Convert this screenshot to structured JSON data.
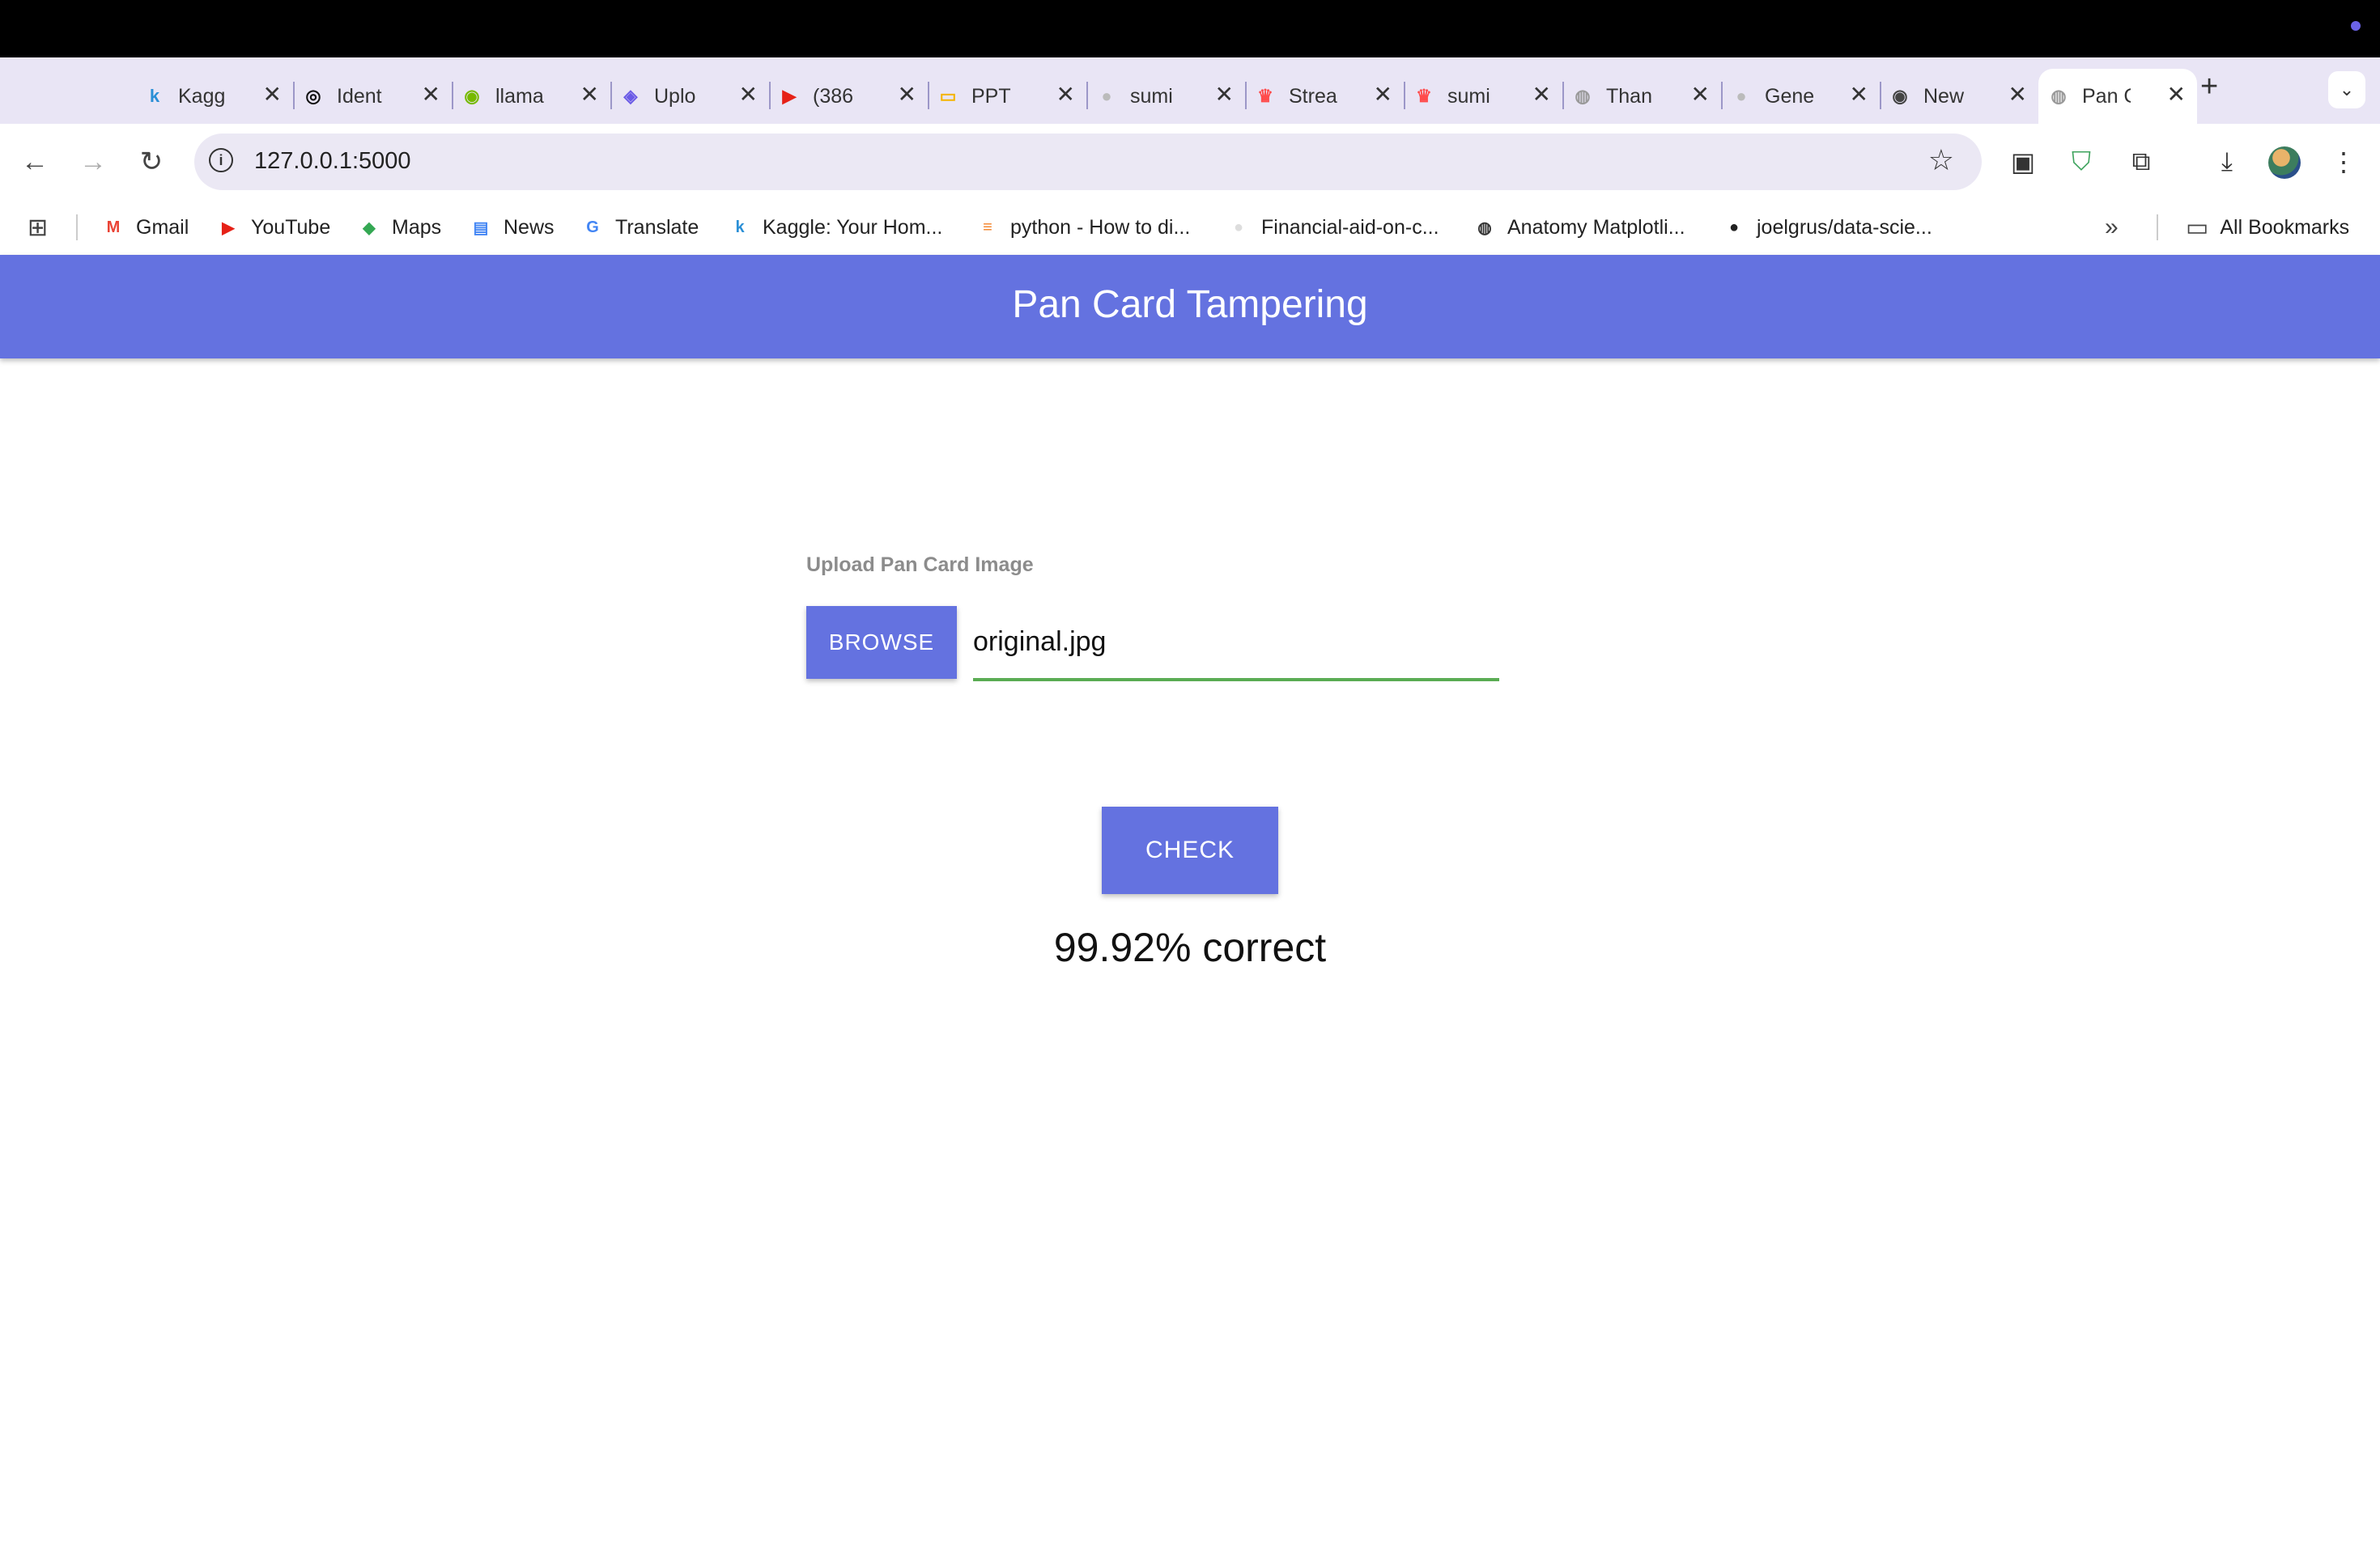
{
  "browser": {
    "tabs": [
      {
        "title": "Kagg",
        "icon": "kaggle-icon",
        "color": "#2a8fd6",
        "glyph": "k"
      },
      {
        "title": "Ident",
        "icon": "openai-icon",
        "color": "#111111",
        "glyph": "◎"
      },
      {
        "title": "llama",
        "icon": "nvidia-icon",
        "color": "#76b900",
        "glyph": "◉"
      },
      {
        "title": "Uplo",
        "icon": "upload-app-icon",
        "color": "#6a5ae6",
        "glyph": "◈"
      },
      {
        "title": "(386",
        "icon": "youtube-icon",
        "color": "#e62117",
        "glyph": "▶"
      },
      {
        "title": "PPT",
        "icon": "slides-icon",
        "color": "#f4b400",
        "glyph": "▭"
      },
      {
        "title": "sumi",
        "icon": "github-icon",
        "color": "#bbbbbb",
        "glyph": "●"
      },
      {
        "title": "Strea",
        "icon": "streamlit-icon",
        "color": "#ff4b4b",
        "glyph": "♛"
      },
      {
        "title": "sumi",
        "icon": "streamlit-app-icon",
        "color": "#ff4b4b",
        "glyph": "♛"
      },
      {
        "title": "Than",
        "icon": "globe-icon",
        "color": "#999999",
        "glyph": "◍"
      },
      {
        "title": "Gene",
        "icon": "github-icon",
        "color": "#bbbbbb",
        "glyph": "●"
      },
      {
        "title": "New",
        "icon": "chrome-icon",
        "color": "#444444",
        "glyph": "◉"
      },
      {
        "title": "Pan C",
        "icon": "globe-icon",
        "color": "#999999",
        "glyph": "◍"
      }
    ],
    "url": "127.0.0.1:5000",
    "bookmarks": [
      {
        "label": "Gmail",
        "icon": "gmail-icon",
        "color": "#ea4335",
        "glyph": "M"
      },
      {
        "label": "YouTube",
        "icon": "youtube-icon",
        "color": "#e62117",
        "glyph": "▶"
      },
      {
        "label": "Maps",
        "icon": "maps-icon",
        "color": "#34a853",
        "glyph": "◆"
      },
      {
        "label": "News",
        "icon": "news-icon",
        "color": "#4285f4",
        "glyph": "▤"
      },
      {
        "label": "Translate",
        "icon": "translate-icon",
        "color": "#4285f4",
        "glyph": "G"
      },
      {
        "label": "Kaggle: Your Hom...",
        "icon": "kaggle-icon",
        "color": "#2a8fd6",
        "glyph": "k"
      },
      {
        "label": "python - How to di...",
        "icon": "stackoverflow-icon",
        "color": "#f48024",
        "glyph": "≡"
      },
      {
        "label": "Financial-aid-on-c...",
        "icon": "github-icon",
        "color": "#dddddd",
        "glyph": "●"
      },
      {
        "label": "Anatomy Matplotli...",
        "icon": "globe-icon",
        "color": "#333333",
        "glyph": "◍"
      },
      {
        "label": "joelgrus/data-scie...",
        "icon": "github-icon",
        "color": "#222222",
        "glyph": "●"
      }
    ],
    "all_bookmarks": "All Bookmarks"
  },
  "app": {
    "title": "Pan Card Tampering",
    "upload_label": "Upload Pan Card Image",
    "browse_label": "BROWSE",
    "file_name": "original.jpg",
    "check_label": "CHECK",
    "result": "99.92% correct"
  }
}
